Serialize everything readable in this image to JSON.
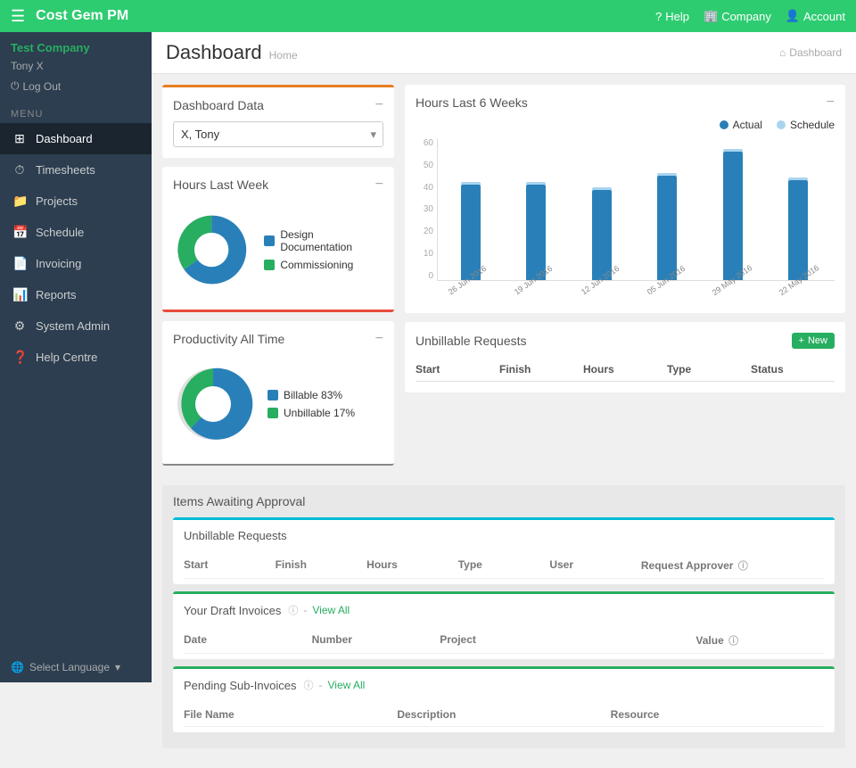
{
  "brand": "Cost Gem PM",
  "topnav": {
    "hamburger": "☰",
    "help": "Help",
    "company": "Company",
    "account": "Account"
  },
  "sidebar": {
    "company": "Test Company",
    "user": "Tony X",
    "logout": "Log Out",
    "menu_label": "MENU",
    "items": [
      {
        "id": "dashboard",
        "label": "Dashboard",
        "icon": "⊞",
        "active": true
      },
      {
        "id": "timesheets",
        "label": "Timesheets",
        "icon": "⊙"
      },
      {
        "id": "projects",
        "label": "Projects",
        "icon": "☰"
      },
      {
        "id": "schedule",
        "label": "Schedule",
        "icon": "📅"
      },
      {
        "id": "invoicing",
        "label": "Invoicing",
        "icon": "📄"
      },
      {
        "id": "reports",
        "label": "Reports",
        "icon": "📊"
      },
      {
        "id": "sysadmin",
        "label": "System Admin",
        "icon": "⚙"
      },
      {
        "id": "helpcentre",
        "label": "Help Centre",
        "icon": "?"
      }
    ],
    "language": "Select Language"
  },
  "page": {
    "title": "Dashboard",
    "breadcrumb": "Home",
    "breadcrumb_icon": "⌂",
    "breadcrumb_label": "Dashboard"
  },
  "dashboard_data": {
    "title": "Dashboard Data",
    "minimize": "−",
    "select_value": "X, Tony",
    "select_options": [
      "X, Tony"
    ]
  },
  "hours_last_week": {
    "title": "Hours Last Week",
    "minimize": "−",
    "legend": [
      {
        "label": "Design Documentation",
        "color": "#2980b9"
      },
      {
        "label": "Commissioning",
        "color": "#27ae60"
      }
    ]
  },
  "productivity_all_time": {
    "title": "Productivity All Time",
    "minimize": "−",
    "legend": [
      {
        "label": "Billable 83%",
        "color": "#2980b9"
      },
      {
        "label": "Unbillable 17%",
        "color": "#27ae60"
      }
    ]
  },
  "hours_6weeks": {
    "title": "Hours Last 6 Weeks",
    "minimize": "−",
    "legend": [
      {
        "label": "Actual",
        "color": "#2980b9"
      },
      {
        "label": "Schedule",
        "color": "#a8d4f0"
      }
    ],
    "y_labels": [
      "60",
      "50",
      "40",
      "30",
      "20",
      "10",
      "0"
    ],
    "bars": [
      {
        "label": "26 Jun 2016",
        "actual": 40,
        "schedule": 1
      },
      {
        "label": "19 Jun 2016",
        "actual": 40,
        "schedule": 1
      },
      {
        "label": "12 Jun 2016",
        "actual": 38,
        "schedule": 1
      },
      {
        "label": "05 Jun 2016",
        "actual": 44,
        "schedule": 1
      },
      {
        "label": "29 May 2016",
        "actual": 54,
        "schedule": 1
      },
      {
        "label": "22 May 2016",
        "actual": 42,
        "schedule": 1
      }
    ],
    "max": 60
  },
  "unbillable_requests": {
    "title": "Unbillable Requests",
    "new_btn": "+ New",
    "cols": [
      "Start",
      "Finish",
      "Hours",
      "Type",
      "Status"
    ]
  },
  "awaiting_approval": {
    "title": "Items Awaiting Approval",
    "unbillable": {
      "title": "Unbillable Requests",
      "cols": [
        "Start",
        "Finish",
        "Hours",
        "Type",
        "User",
        "Request Approver"
      ]
    },
    "draft_invoices": {
      "title": "Your Draft Invoices",
      "view_all": "View All",
      "cols": [
        "Date",
        "Number",
        "Project",
        "Value"
      ]
    },
    "pending_sub": {
      "title": "Pending Sub-Invoices",
      "view_all": "View All",
      "cols": [
        "File Name",
        "Description",
        "Resource"
      ]
    }
  }
}
